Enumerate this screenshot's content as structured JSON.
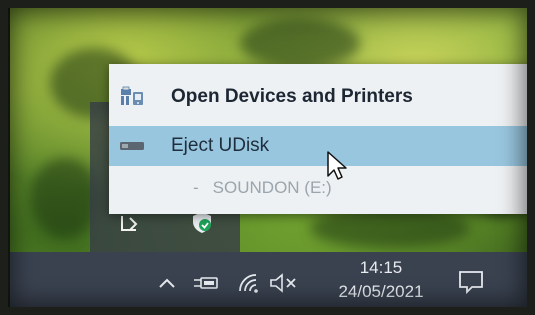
{
  "menu": {
    "items": [
      {
        "label": "Open Devices and Printers",
        "icon": "devices-printers-icon"
      },
      {
        "label": "Eject UDisk",
        "icon": "usb-drive-icon"
      }
    ],
    "sub_item": {
      "dash": "-",
      "label": "SOUNDON (E:)"
    }
  },
  "taskbar": {
    "time": "14:15",
    "date": "24/05/2021",
    "icons": [
      "chevron-up-icon",
      "power-plug-icon",
      "wifi-icon",
      "speaker-muted-icon",
      "notification-icon"
    ]
  },
  "colors": {
    "menu_bg": "#eef1f3",
    "highlight": "#99c6df",
    "taskbar": "#3a4250",
    "tray_overflow": "#373e46"
  }
}
